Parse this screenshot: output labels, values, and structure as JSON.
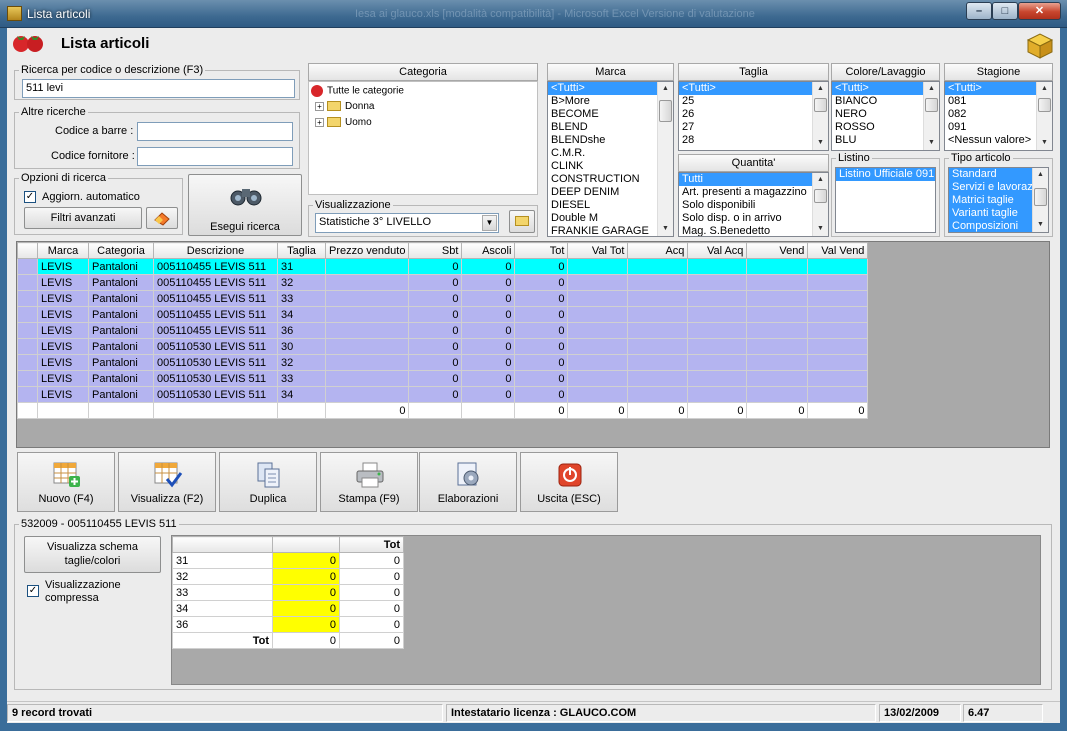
{
  "window": {
    "title": "Lista articoli",
    "background_title": "Iesa ai glauco.xls [modalità compatibilità] - Microsoft Excel Versione di valutazione",
    "minimize": "–",
    "maximize": "□",
    "close": "✕"
  },
  "header": {
    "title": "Lista articoli"
  },
  "search": {
    "legend": "Ricerca per codice o descrizione (F3)",
    "value": "511 levi",
    "other_legend": "Altre ricerche",
    "barcode_label": "Codice a barre :",
    "supplier_label": "Codice fornitore :",
    "options_legend": "Opzioni di ricerca",
    "auto_update_label": "Aggiorn. automatico",
    "auto_update_checked": "✓",
    "advanced_filters": "Filtri avanzati",
    "execute_label": "Esegui ricerca"
  },
  "categoria": {
    "header": "Categoria",
    "root": "Tutte le categorie",
    "children": [
      "Donna",
      "Uomo"
    ],
    "expander": "+"
  },
  "visualizzazione": {
    "legend": "Visualizzazione",
    "selected": "Statistiche 3° LIVELLO"
  },
  "marca": {
    "header": "Marca",
    "items": [
      "<Tutti>",
      "B>More",
      "BECOME",
      "BLEND",
      "BLENDshe",
      "C.M.R.",
      "CLINK",
      "CONSTRUCTION",
      "DEEP DENIM",
      "DIESEL",
      "Double M",
      "FRANKIE GARAGE"
    ]
  },
  "taglia": {
    "header": "Taglia",
    "items": [
      "<Tutti>",
      "25",
      "26",
      "27",
      "28"
    ]
  },
  "quantita": {
    "header": "Quantita'",
    "items": [
      "Tutti",
      "Art. presenti a magazzino",
      "Solo disponibili",
      "Solo disp. o in arrivo",
      "Mag. S.Benedetto"
    ]
  },
  "colore": {
    "header": "Colore/Lavaggio",
    "items": [
      "<Tutti>",
      "BIANCO",
      "NERO",
      "ROSSO",
      "BLU"
    ]
  },
  "stagione": {
    "header": "Stagione",
    "items": [
      "<Tutti>",
      "081",
      "082",
      "091",
      "<Nessun valore>"
    ]
  },
  "listino": {
    "legend": "Listino",
    "items": [
      "Listino Ufficiale 091"
    ]
  },
  "tipo": {
    "legend": "Tipo articolo",
    "items": [
      "Standard",
      "Servizi e lavorazioni",
      "Matrici taglie",
      "Varianti taglie",
      "Composizioni"
    ]
  },
  "grid": {
    "columns": [
      "",
      "Marca",
      "Categoria",
      "Descrizione",
      "Taglia",
      "Prezzo venduto",
      "Sbt",
      "Ascoli",
      "Tot",
      "Val Tot",
      "Acq",
      "Val Acq",
      "Vend",
      "Val Vend"
    ],
    "rows": [
      [
        "",
        "LEVIS",
        "Pantaloni",
        "005110455 LEVIS 511",
        "31",
        "",
        "0",
        "0",
        "0",
        "",
        "",
        "",
        "",
        ""
      ],
      [
        "",
        "LEVIS",
        "Pantaloni",
        "005110455 LEVIS 511",
        "32",
        "",
        "0",
        "0",
        "0",
        "",
        "",
        "",
        "",
        ""
      ],
      [
        "",
        "LEVIS",
        "Pantaloni",
        "005110455 LEVIS 511",
        "33",
        "",
        "0",
        "0",
        "0",
        "",
        "",
        "",
        "",
        ""
      ],
      [
        "",
        "LEVIS",
        "Pantaloni",
        "005110455 LEVIS 511",
        "34",
        "",
        "0",
        "0",
        "0",
        "",
        "",
        "",
        "",
        ""
      ],
      [
        "",
        "LEVIS",
        "Pantaloni",
        "005110455 LEVIS 511",
        "36",
        "",
        "0",
        "0",
        "0",
        "",
        "",
        "",
        "",
        ""
      ],
      [
        "",
        "LEVIS",
        "Pantaloni",
        "005110530 LEVIS 511",
        "30",
        "",
        "0",
        "0",
        "0",
        "",
        "",
        "",
        "",
        ""
      ],
      [
        "",
        "LEVIS",
        "Pantaloni",
        "005110530 LEVIS 511",
        "32",
        "",
        "0",
        "0",
        "0",
        "",
        "",
        "",
        "",
        ""
      ],
      [
        "",
        "LEVIS",
        "Pantaloni",
        "005110530 LEVIS 511",
        "33",
        "",
        "0",
        "0",
        "0",
        "",
        "",
        "",
        "",
        ""
      ],
      [
        "",
        "LEVIS",
        "Pantaloni",
        "005110530 LEVIS 511",
        "34",
        "",
        "0",
        "0",
        "0",
        "",
        "",
        "",
        "",
        ""
      ]
    ],
    "totals": [
      "",
      "",
      "",
      "",
      "",
      "0",
      "",
      "",
      "0",
      "0",
      "0",
      "0",
      "0",
      "0"
    ]
  },
  "toolbar": {
    "nuovo": "Nuovo (F4)",
    "visualizza": "Visualizza (F2)",
    "duplica": "Duplica",
    "stampa": "Stampa (F9)",
    "elaborazioni": "Elaborazioni",
    "uscita": "Uscita (ESC)"
  },
  "detail": {
    "legend": "532009 - 005110455 LEVIS 511",
    "schema_button": "Visualizza schema taglie/colori",
    "compressed_label": "Visualizzazione compressa",
    "compressed_checked": "✓",
    "header": [
      "",
      "",
      "Tot"
    ],
    "rows": [
      [
        "31",
        "0",
        "0"
      ],
      [
        "32",
        "0",
        "0"
      ],
      [
        "33",
        "0",
        "0"
      ],
      [
        "34",
        "0",
        "0"
      ],
      [
        "36",
        "0",
        "0"
      ]
    ],
    "total_row": [
      "Tot",
      "0",
      "0"
    ]
  },
  "status": {
    "records": "9 record trovati",
    "license": "Intestatario licenza : GLAUCO.COM",
    "date": "13/02/2009",
    "version": "6.47"
  },
  "colors": {
    "selected_row": "#00ffff",
    "rows": "#b4b4f0",
    "highlight": "#ffff00",
    "selection": "#3399ff"
  }
}
